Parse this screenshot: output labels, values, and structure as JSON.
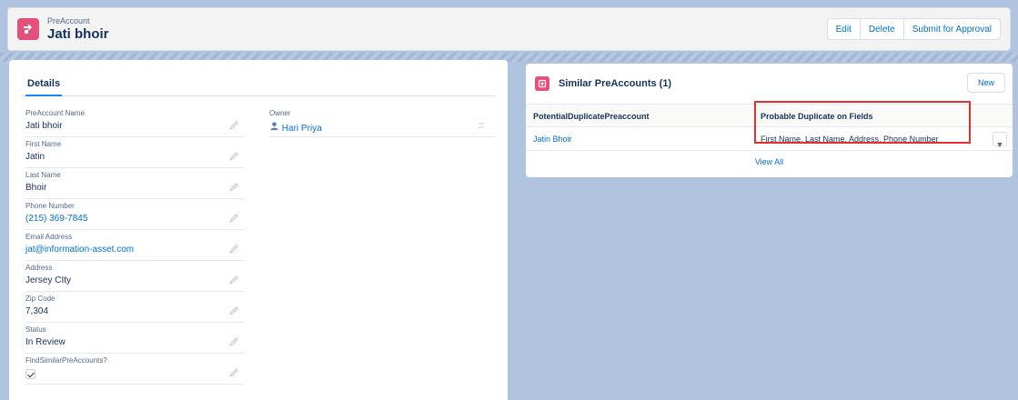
{
  "header": {
    "object_type": "PreAccount",
    "record_name": "Jati bhoir",
    "buttons": {
      "edit": "Edit",
      "delete": "Delete",
      "submit": "Submit for Approval"
    }
  },
  "details": {
    "tab_label": "Details",
    "fields": [
      {
        "label": "PreAccount Name",
        "value": "Jati bhoir"
      },
      {
        "label": "First Name",
        "value": "Jatin"
      },
      {
        "label": "Last Name",
        "value": "Bhoir"
      },
      {
        "label": "Phone Number",
        "value": "(215) 369-7845"
      },
      {
        "label": "Email Address",
        "value": "jat@information-asset.com"
      },
      {
        "label": "Address",
        "value": "Jersey CIty"
      },
      {
        "label": "Zip Code",
        "value": "7,304"
      },
      {
        "label": "Status",
        "value": "In Review"
      },
      {
        "label": "FindSimilarPreAccounts?",
        "value": true
      }
    ],
    "owner": {
      "label": "Owner",
      "value": "Hari Priya"
    }
  },
  "similar": {
    "title": "Similar PreAccounts (1)",
    "new_label": "New",
    "columns": [
      "PotentialDuplicatePreaccount",
      "Probable Duplicate on Fields"
    ],
    "rows": [
      {
        "name": "Jatin Bhoir",
        "fields": "First Name, Last Name, Address, Phone Number"
      }
    ],
    "view_all": "View All"
  },
  "colors": {
    "brand_icon": "#e3507a",
    "link": "#0070d2",
    "highlight": "#e03131",
    "background": "#b0c4df"
  }
}
